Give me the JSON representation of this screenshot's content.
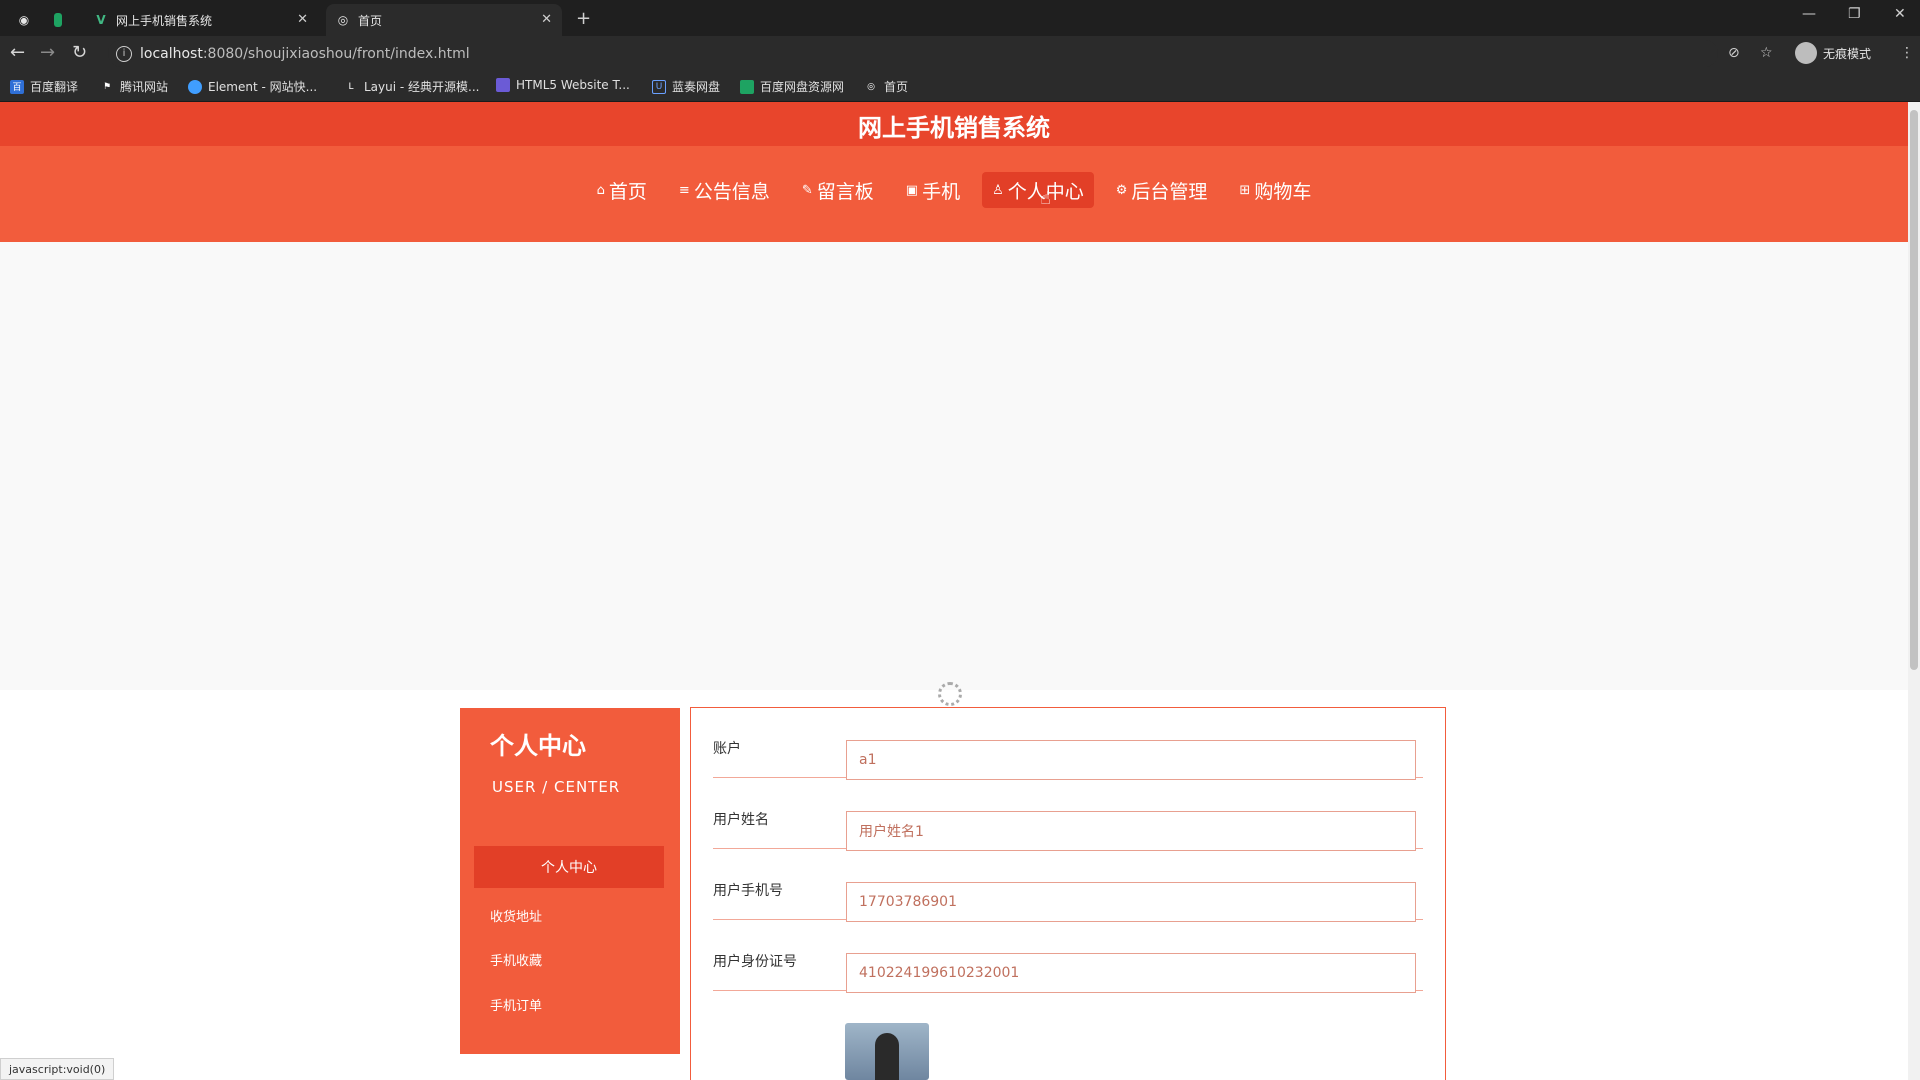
{
  "browser": {
    "tabs": [
      {
        "title": "网上手机销售系统",
        "icon": "vue-icon"
      },
      {
        "title": "首页",
        "icon": "globe-icon"
      }
    ],
    "url_host": "localhost",
    "url_path": ":8080/shoujixiaoshou/front/index.html",
    "profile_label": "无痕模式",
    "bookmarks": [
      "百度翻译",
      "腾讯网站",
      "Element - 网站快...",
      "Layui - 经典开源模...",
      "HTML5 Website T...",
      "蓝奏网盘",
      "百度网盘资源网",
      "首页"
    ]
  },
  "site": {
    "title": "网上手机销售系统",
    "nav": [
      {
        "label": "首页",
        "icon": "⌂"
      },
      {
        "label": "公告信息",
        "icon": "≡"
      },
      {
        "label": "留言板",
        "icon": "✎"
      },
      {
        "label": "手机",
        "icon": "▣"
      },
      {
        "label": "个人中心",
        "icon": "♙",
        "active": true
      },
      {
        "label": "后台管理",
        "icon": "⚙"
      },
      {
        "label": "购物车",
        "icon": "⊞"
      }
    ]
  },
  "sidebar": {
    "title": "个人中心",
    "subtitle": "USER / CENTER",
    "active_item": "个人中心",
    "items": [
      "收货地址",
      "手机收藏",
      "手机订单"
    ]
  },
  "form": {
    "account": {
      "label": "账户",
      "value": "a1"
    },
    "name": {
      "label": "用户姓名",
      "value": "用户姓名1"
    },
    "phone": {
      "label": "用户手机号",
      "value": "17703786901"
    },
    "id_card": {
      "label": "用户身份证号",
      "value": "410224199610232001"
    }
  },
  "status_text": "javascript:void(0)",
  "colors": {
    "brand": "#f25c3c",
    "brand_dark": "#e23f27"
  }
}
